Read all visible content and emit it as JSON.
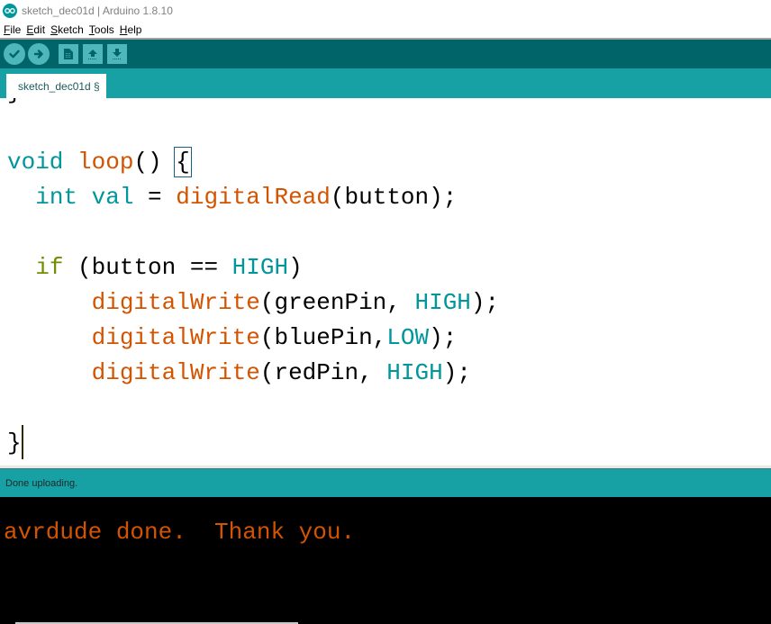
{
  "window": {
    "title": "sketch_dec01d | Arduino 1.8.10",
    "logo_icon": "arduino-infinity-logo"
  },
  "menubar": {
    "items": [
      {
        "label_ul": "F",
        "label_rest": "ile"
      },
      {
        "label_ul": "E",
        "label_rest": "dit"
      },
      {
        "label_ul": "S",
        "label_rest": "ketch"
      },
      {
        "label_ul": "T",
        "label_rest": "ools"
      },
      {
        "label_ul": "H",
        "label_rest": "elp"
      }
    ]
  },
  "toolbar": {
    "buttons": [
      {
        "name": "verify",
        "icon": "checkmark-icon"
      },
      {
        "name": "upload",
        "icon": "arrow-right-icon"
      },
      {
        "name": "new",
        "icon": "new-file-icon"
      },
      {
        "name": "open",
        "icon": "arrow-up-icon"
      },
      {
        "name": "save",
        "icon": "arrow-down-icon"
      }
    ]
  },
  "tabs": [
    {
      "label": "sketch_dec01d §",
      "active": true
    }
  ],
  "editor": {
    "lines": [
      {
        "tokens": [
          {
            "t": "}",
            "c": "plain"
          }
        ]
      },
      {
        "tokens": []
      },
      {
        "tokens": [
          {
            "t": "void",
            "c": "kw"
          },
          {
            "t": " ",
            "c": "plain"
          },
          {
            "t": "loop",
            "c": "fn"
          },
          {
            "t": "() ",
            "c": "plain"
          },
          {
            "t": "{",
            "c": "brace"
          }
        ]
      },
      {
        "tokens": [
          {
            "t": "  ",
            "c": "plain"
          },
          {
            "t": "int",
            "c": "kw"
          },
          {
            "t": " ",
            "c": "plain"
          },
          {
            "t": "val",
            "c": "kw"
          },
          {
            "t": " = ",
            "c": "plain"
          },
          {
            "t": "digitalRead",
            "c": "fn"
          },
          {
            "t": "(button);",
            "c": "plain"
          }
        ]
      },
      {
        "tokens": []
      },
      {
        "tokens": [
          {
            "t": "  ",
            "c": "plain"
          },
          {
            "t": "if",
            "c": "ctl"
          },
          {
            "t": " (button == ",
            "c": "plain"
          },
          {
            "t": "HIGH",
            "c": "kw"
          },
          {
            "t": ")",
            "c": "plain"
          }
        ]
      },
      {
        "tokens": [
          {
            "t": "      ",
            "c": "plain"
          },
          {
            "t": "digitalWrite",
            "c": "fn"
          },
          {
            "t": "(greenPin, ",
            "c": "plain"
          },
          {
            "t": "HIGH",
            "c": "kw"
          },
          {
            "t": ");",
            "c": "plain"
          }
        ]
      },
      {
        "tokens": [
          {
            "t": "      ",
            "c": "plain"
          },
          {
            "t": "digitalWrite",
            "c": "fn"
          },
          {
            "t": "(bluePin,",
            "c": "plain"
          },
          {
            "t": "LOW",
            "c": "kw"
          },
          {
            "t": ");",
            "c": "plain"
          }
        ]
      },
      {
        "tokens": [
          {
            "t": "      ",
            "c": "plain"
          },
          {
            "t": "digitalWrite",
            "c": "fn"
          },
          {
            "t": "(redPin, ",
            "c": "plain"
          },
          {
            "t": "HIGH",
            "c": "kw"
          },
          {
            "t": ");",
            "c": "plain"
          }
        ]
      },
      {
        "tokens": []
      },
      {
        "tokens": [
          {
            "t": "}",
            "c": "plain"
          }
        ]
      }
    ]
  },
  "status": {
    "message": "Done uploading."
  },
  "console": {
    "output": "avrdude done.  Thank you."
  },
  "colors": {
    "toolbar_bg": "#006468",
    "tabbar_bg": "#17a1a5",
    "keyword": "#00979c",
    "function": "#d35400",
    "control": "#728e00",
    "console_text": "#d35400"
  }
}
